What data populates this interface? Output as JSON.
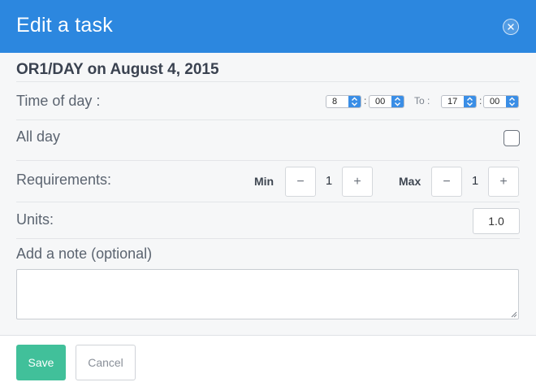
{
  "header": {
    "title": "Edit a task",
    "close_icon": "close-icon",
    "color": "#2c87df"
  },
  "task": {
    "subtitle": "OR1/DAY on August 4, 2015"
  },
  "time_of_day": {
    "label": "Time of day :",
    "from_hour": "8",
    "from_minute": "00",
    "separator": ":",
    "to_label": "To :",
    "to_hour": "17",
    "to_minute": "00"
  },
  "all_day": {
    "label": "All day",
    "checked": false
  },
  "requirements": {
    "label": "Requirements:",
    "min_label": "Min",
    "min_value": "1",
    "max_label": "Max",
    "max_value": "1",
    "decrement_symbol": "−",
    "increment_symbol": "+"
  },
  "units": {
    "label": "Units:",
    "value": "1.0"
  },
  "note": {
    "label": "Add a note (optional)",
    "value": ""
  },
  "footer": {
    "save_label": "Save",
    "cancel_label": "Cancel",
    "save_color": "#41c09a"
  }
}
